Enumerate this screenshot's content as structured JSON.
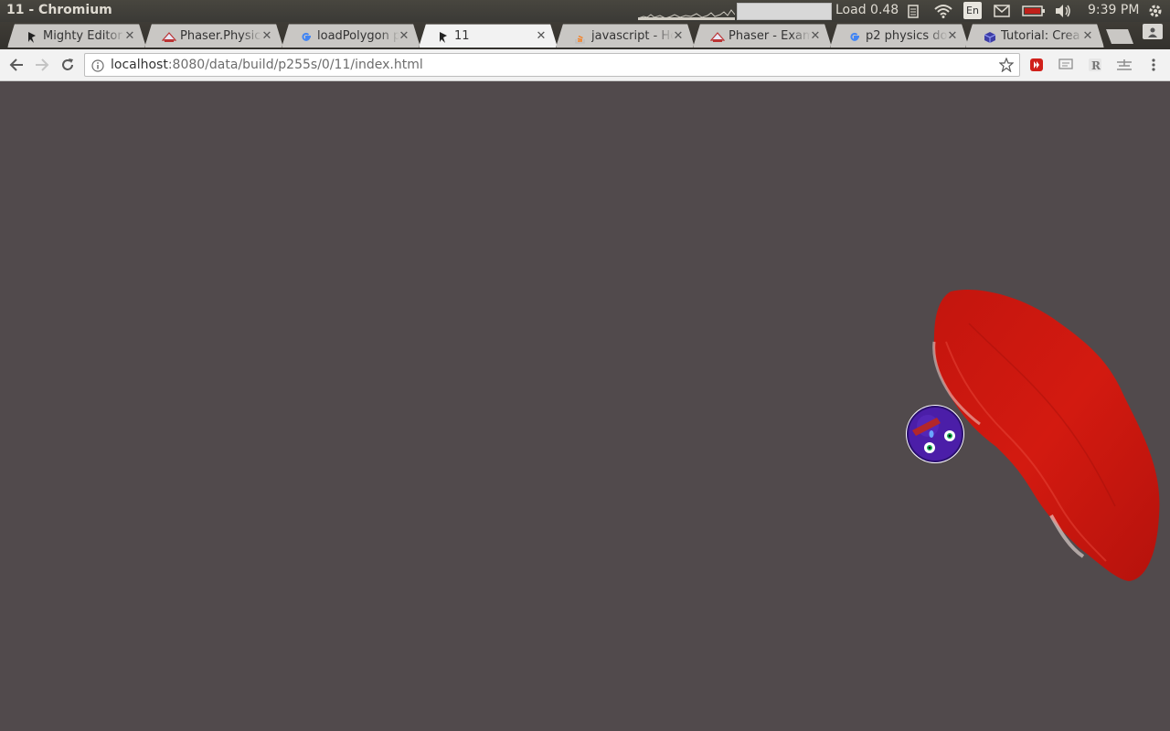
{
  "os": {
    "window_title": "11 - Chromium",
    "load_label": "Load 0.48",
    "lang_indicator": "En",
    "clock": "9:39 PM"
  },
  "tabs": [
    {
      "title": "Mighty Editor",
      "favicon": "mighty-editor-icon",
      "active": false
    },
    {
      "title": "Phaser.Physics",
      "favicon": "phaser-icon",
      "active": false
    },
    {
      "title": "loadPolygon p",
      "favicon": "google-icon",
      "active": false
    },
    {
      "title": "11",
      "favicon": "mighty-editor-icon",
      "active": true
    },
    {
      "title": "javascript - Ho",
      "favicon": "stackoverflow-icon",
      "active": false
    },
    {
      "title": "Phaser - Exam",
      "favicon": "phaser-icon",
      "active": false
    },
    {
      "title": "p2 physics do",
      "favicon": "google-icon",
      "active": false
    },
    {
      "title": "Tutorial: Crea",
      "favicon": "cube-icon",
      "active": false
    }
  ],
  "address_bar": {
    "host": "localhost",
    "path": ":8080/data/build/p255s/0/11/index.html"
  },
  "colors": {
    "canvas_bg": "#514a4c",
    "sushi_red": "#d0160e",
    "ball_purple": "#4b1ea8"
  }
}
